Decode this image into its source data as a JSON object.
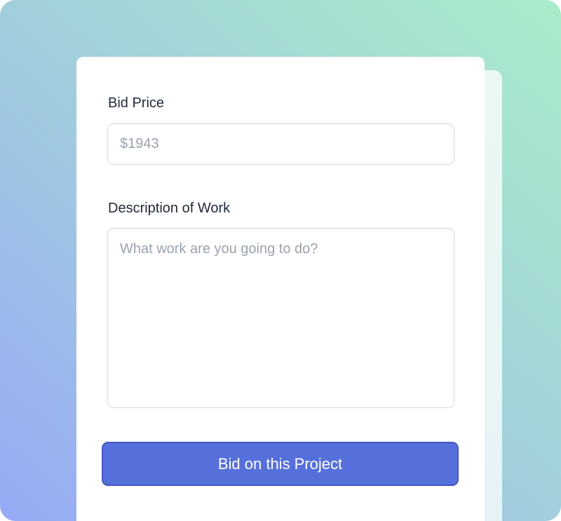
{
  "form": {
    "price_label": "Bid Price",
    "price_placeholder": "$1943",
    "price_value": "",
    "description_label": "Description of Work",
    "description_placeholder": "What work are you going to do?",
    "description_value": "",
    "submit_label": "Bid on this Project"
  },
  "colors": {
    "accent": "#5670db",
    "accent_border": "#4456c4",
    "label_text": "#1f2a37",
    "placeholder_text": "#9aa3af",
    "background_gradient": [
      "#97a9f6",
      "#a1cfdc",
      "#aaecc9"
    ]
  }
}
